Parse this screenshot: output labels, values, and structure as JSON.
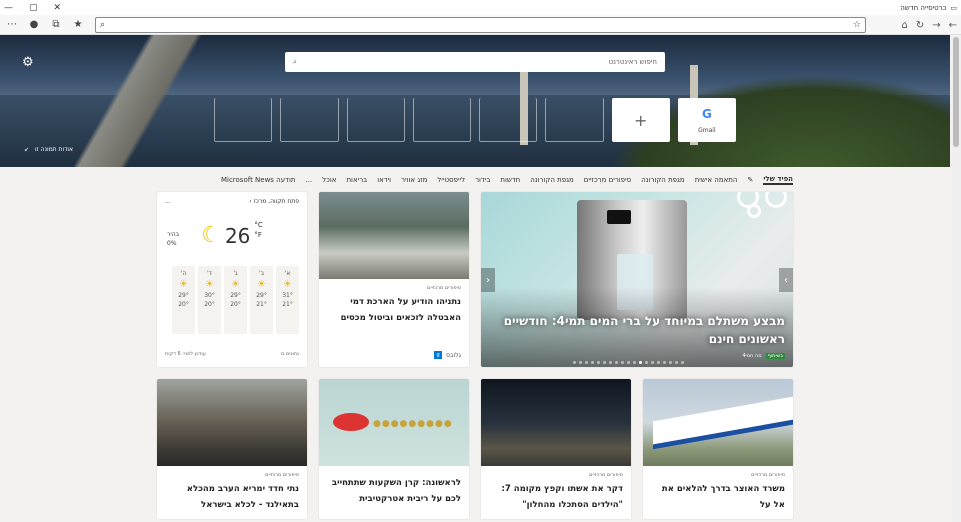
{
  "window": {
    "title": "כרטיסייה חדשה",
    "minimize": "—",
    "maximize": "▢",
    "close": "✕"
  },
  "toolbar": {
    "back_icon": "arrow-left-icon",
    "forward_icon": "arrow-right-icon",
    "refresh_icon": "refresh-icon",
    "home_icon": "home-icon",
    "address_placeholder": "",
    "menu_icon": "more-icon"
  },
  "search": {
    "placeholder": "חיפוש ראינטרנט"
  },
  "hero": {
    "caption": "אודות תמונה זו",
    "tiles": [
      {
        "label": "",
        "type": "empty"
      },
      {
        "label": "",
        "type": "empty"
      },
      {
        "label": "",
        "type": "empty"
      },
      {
        "label": "",
        "type": "empty"
      },
      {
        "label": "",
        "type": "empty"
      },
      {
        "label": "",
        "type": "empty"
      },
      {
        "label": "+",
        "type": "add"
      },
      {
        "label": "Gmail",
        "type": "gmail",
        "glyph": "G"
      }
    ]
  },
  "categories": {
    "items": [
      "הפיד שלי",
      "התאמה אישית",
      "מגפת הקורונה",
      "סיפורים מרכזיים",
      "מגפת הקורונה",
      "חדשות",
      "בידור",
      "לייפסטייל",
      "מזג אוויר",
      "וידאו",
      "בריאות",
      "אוכל",
      "...",
      "תודעה Microsoft News"
    ]
  },
  "featured": {
    "headline": "מבצע משתלם במיוחד על ברי המים תמי4: חודשיים ראשונים חינם",
    "tag": "בשיתוף",
    "source": "מה תמי4"
  },
  "stories": [
    {
      "meta": "סיפורים מרכזיים",
      "title": "נתניהו הודיע על הארכת דמי האבטלה לזכאים וביטול מכסים",
      "source": "גלובס"
    },
    {
      "meta": "סיפורים מרכזיים",
      "title": "משרד האוצר בדרך להלאים את אל על",
      "source": ""
    },
    {
      "meta": "סיפורים מרכזיים",
      "title": "דקר את אשתו וקפץ מקומה 7: \"הילדים הסתכלו מהחלון\"",
      "source": ""
    },
    {
      "meta": "",
      "title": "לראשונה: קרן השקעות שתתחייב לכם על ריבית אטרקטיבית",
      "source": ""
    },
    {
      "meta": "סיפורים מרכזיים",
      "title": "נתי חדד ימריא הערב מהכלא בתאילנד - לכלא בישראל",
      "source": ""
    }
  ],
  "weather": {
    "location": "פתח תקווה, מרכז",
    "more": "...",
    "temp": "26",
    "unit_c": "°C",
    "unit_f": "°F",
    "condition": "בהיר",
    "humidity": "0%",
    "days": [
      {
        "day": "א'",
        "high": "31°",
        "low": "21°"
      },
      {
        "day": "ב'",
        "high": "29°",
        "low": "21°"
      },
      {
        "day": "ג'",
        "high": "29°",
        "low": "20°"
      },
      {
        "day": "ד'",
        "high": "30°",
        "low": "20°"
      },
      {
        "day": "ה'",
        "high": "29°",
        "low": "20°"
      }
    ],
    "footer_right": "נתונים מ",
    "footer_left": "עודכן לפני: 6 דקות"
  }
}
